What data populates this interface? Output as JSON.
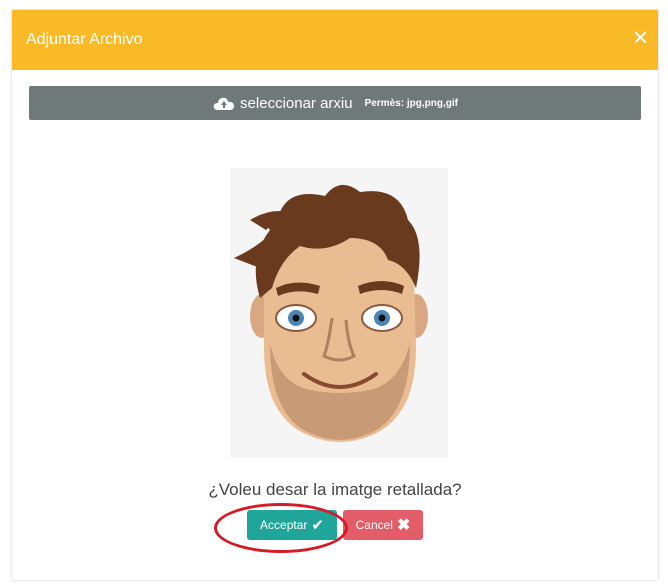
{
  "modal": {
    "title": "Adjuntar Archivo",
    "close_icon": "×"
  },
  "file_select": {
    "icon": "cloud-upload-icon",
    "label": "seleccionar arxiu",
    "allowed": "Permès: jpg,png,gif"
  },
  "preview": {
    "image": "cartoon-man-face-avatar"
  },
  "prompt": {
    "question": "¿Voleu desar la imatge retallada?"
  },
  "buttons": {
    "accept": "Acceptar",
    "cancel": "Cancel"
  },
  "colors": {
    "header": "#f9ba27",
    "select_bar": "#6f7a78",
    "accept": "#1fa59a",
    "cancel": "#e25d67",
    "highlight": "#d41b26"
  }
}
